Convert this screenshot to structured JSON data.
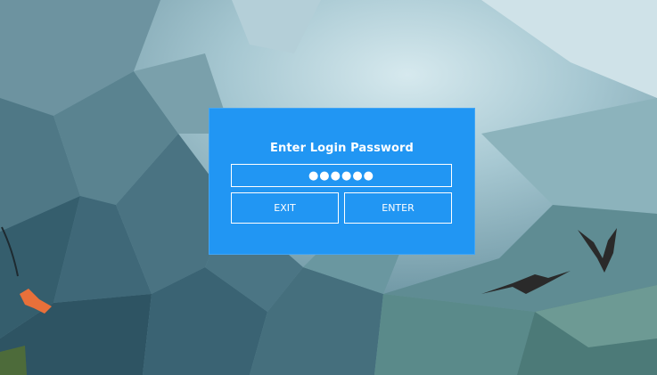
{
  "dialog": {
    "title": "Enter Login Password",
    "password_value": "●●●●●●",
    "exit_label": "EXIT",
    "enter_label": "ENTER"
  },
  "colors": {
    "dialog_background": "#2196f3",
    "dialog_text": "#ffffff",
    "bird": "#2a2a2a",
    "accent_orange": "#e8703a"
  },
  "icons": [
    "bird-illustration",
    "kite-illustration"
  ]
}
